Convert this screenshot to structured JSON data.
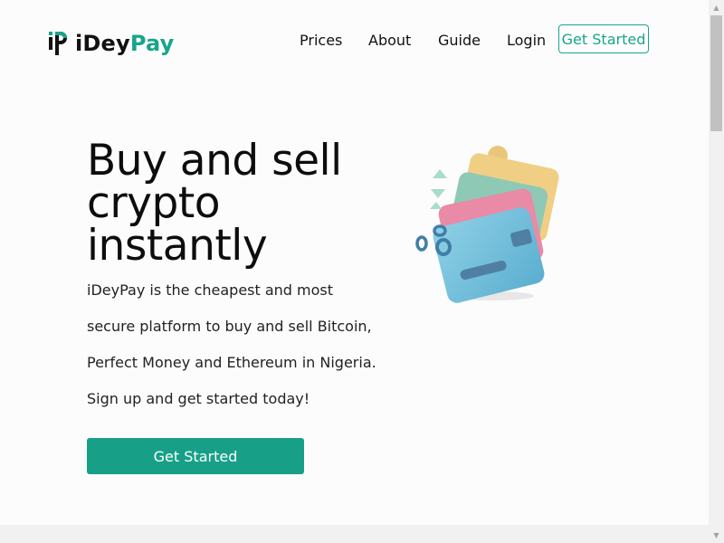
{
  "brand": {
    "name_part1": "iDey",
    "name_part2": "Pay",
    "accent_color": "#17a58b",
    "logo_icon": "idp-logo-icon"
  },
  "nav": {
    "links": [
      "Prices",
      "About",
      "Guide",
      "Login"
    ],
    "cta_label": "Get Started"
  },
  "hero": {
    "title_lines": [
      "Buy and sell",
      "crypto",
      "instantly"
    ],
    "paragraph_lines": [
      "iDeyPay is the cheapest and most",
      "secure platform to buy and sell Bitcoin,",
      "Perfect Money and Ethereum in Nigeria.",
      "Sign up and get started today!"
    ],
    "cta_label": "Get Started",
    "illustration_icon": "wallet-cards-illustration"
  }
}
